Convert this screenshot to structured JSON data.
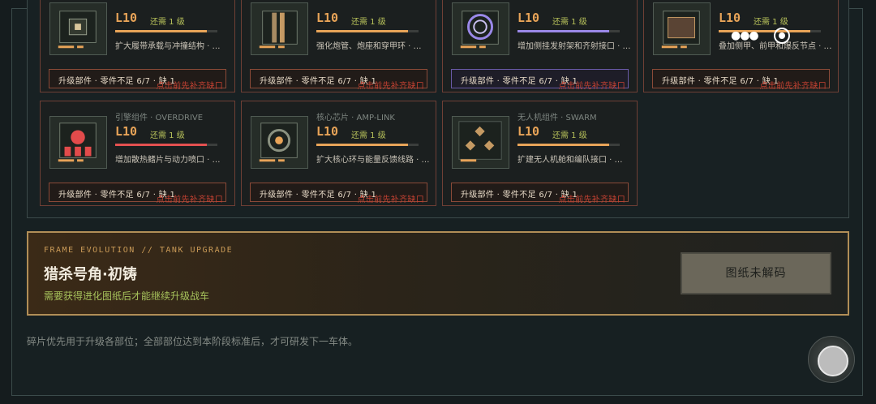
{
  "cards": [
    {
      "subtitle": "",
      "level": "L10",
      "need": "还需 1 级",
      "desc": "扩大履带承载与冲撞结构 · …",
      "progress": 0.9,
      "bar_color": "#e8a458",
      "icon": "tread-module-icon",
      "upgrade_label": "升级部件 · 零件不足 6/7 · 缺 1",
      "hint": "点击前先补齐缺口"
    },
    {
      "subtitle": "",
      "level": "L10",
      "need": "还需 1 级",
      "desc": "强化炮管、炮座和穿甲环 · …",
      "progress": 0.9,
      "bar_color": "#e8a458",
      "icon": "cannon-module-icon",
      "upgrade_label": "升级部件 · 零件不足 6/7 · 缺 1",
      "hint": "点击前先补齐缺口"
    },
    {
      "subtitle": "",
      "level": "L10",
      "need": "还需 1 级",
      "desc": "增加侧挂发射架和齐射接口 · …",
      "progress": 0.9,
      "bar_color": "#9a88e8",
      "icon": "launcher-module-icon",
      "upgrade_label": "升级部件 · 零件不足 6/7 · 缺 1",
      "hint": "点击前先补齐缺口"
    },
    {
      "subtitle": "",
      "level": "L10",
      "need": "还需 1 级",
      "desc": "叠加侧甲、前甲和爆反节点 · …",
      "progress": 0.9,
      "bar_color": "#e8a458",
      "icon": "armor-module-icon",
      "upgrade_label": "升级部件 · 零件不足 6/7 · 缺 1",
      "hint": "点击前先补齐缺口"
    },
    {
      "subtitle": "引擎组件 · OVERDRIVE",
      "level": "L10",
      "need": "还需 1 级",
      "desc": "增加散热鳍片与动力喷口 · …",
      "progress": 0.9,
      "bar_color": "#e45050",
      "icon": "engine-module-icon",
      "upgrade_label": "升级部件 · 零件不足 6/7 · 缺 1",
      "hint": "点击前先补齐缺口"
    },
    {
      "subtitle": "核心芯片 · AMP-LINK",
      "level": "L10",
      "need": "还需 1 级",
      "desc": "扩大核心环与能量反馈线路 · …",
      "progress": 0.9,
      "bar_color": "#e8a458",
      "icon": "core-chip-icon",
      "upgrade_label": "升级部件 · 零件不足 6/7 · 缺 1",
      "hint": "点击前先补齐缺口"
    },
    {
      "subtitle": "无人机组件 · SWARM",
      "level": "L10",
      "need": "还需 1 级",
      "desc": "扩建无人机舱和编队接口 · …",
      "progress": 0.9,
      "bar_color": "#e8a458",
      "icon": "drone-module-icon",
      "upgrade_label": "升级部件 · 零件不足 6/7 · 缺 1",
      "hint": "点击前先补齐缺口"
    }
  ],
  "evolution": {
    "tag": "FRAME EVOLUTION // TANK UPGRADE",
    "title": "猎杀号角·初铸",
    "note": "需要获得进化图纸后才能继续升级战车",
    "button": "图纸未解码"
  },
  "footer": "碎片优先用于升级各部位；全部部位达到本阶段标准后，才可研发下一车体。",
  "capsule": {
    "more_icon": "more-dots-icon",
    "close_icon": "close-target-icon"
  },
  "colors": {
    "accent": "#e8a458",
    "warning": "#c24132",
    "ok": "#b7c15a",
    "gold_border": "#b18e57"
  }
}
